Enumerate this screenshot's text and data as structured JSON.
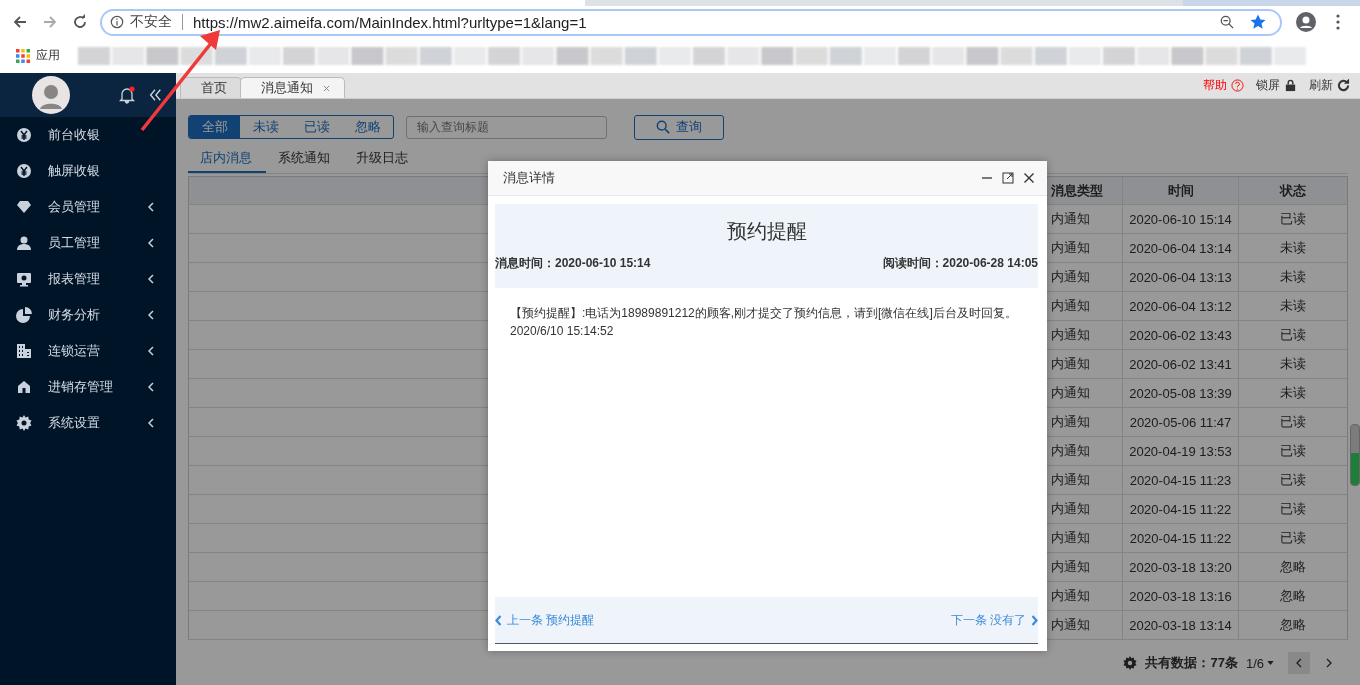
{
  "browser": {
    "security_label": "不安全",
    "url": "https://mw2.aimeifa.com/MainIndex.html?urltype=1&lang=1",
    "bookmarks_label": "应用"
  },
  "bell": {
    "has_unread": true
  },
  "sidebar": {
    "items": [
      {
        "label": "前台收银",
        "has_submenu": false
      },
      {
        "label": "触屏收银",
        "has_submenu": false
      },
      {
        "label": "会员管理",
        "has_submenu": true
      },
      {
        "label": "员工管理",
        "has_submenu": true
      },
      {
        "label": "报表管理",
        "has_submenu": true
      },
      {
        "label": "财务分析",
        "has_submenu": true
      },
      {
        "label": "连锁运营",
        "has_submenu": true
      },
      {
        "label": "进销存管理",
        "has_submenu": true
      },
      {
        "label": "系统设置",
        "has_submenu": true
      }
    ]
  },
  "tabs": [
    {
      "label": "首页",
      "selected": false,
      "closable": false
    },
    {
      "label": "消息通知",
      "selected": true,
      "closable": true
    }
  ],
  "toolbar": [
    {
      "label": "帮助",
      "color": "#ff0000"
    },
    {
      "label": "锁屏",
      "color": "#333333"
    },
    {
      "label": "刷新",
      "color": "#333333"
    }
  ],
  "filters": [
    {
      "label": "全部",
      "selected": true
    },
    {
      "label": "未读",
      "selected": false
    },
    {
      "label": "已读",
      "selected": false
    },
    {
      "label": "忽略",
      "selected": false
    }
  ],
  "search": {
    "placeholder": "输入查询标题"
  },
  "search_button": "查询",
  "subtabs": [
    {
      "label": "店内消息",
      "selected": true
    },
    {
      "label": "系统通知",
      "selected": false
    },
    {
      "label": "升级日志",
      "selected": false
    }
  ],
  "table": {
    "columns": [
      "消息类型",
      "时间",
      "状态"
    ],
    "rows": [
      {
        "type": "内通知",
        "time": "2020-06-10 15:14",
        "status": "已读"
      },
      {
        "type": "内通知",
        "time": "2020-06-04 13:14",
        "status": "未读"
      },
      {
        "type": "内通知",
        "time": "2020-06-04 13:13",
        "status": "未读"
      },
      {
        "type": "内通知",
        "time": "2020-06-04 13:12",
        "status": "未读"
      },
      {
        "type": "内通知",
        "time": "2020-06-02 13:43",
        "status": "已读"
      },
      {
        "type": "内通知",
        "time": "2020-06-02 13:41",
        "status": "未读"
      },
      {
        "type": "内通知",
        "time": "2020-05-08 13:39",
        "status": "未读"
      },
      {
        "type": "内通知",
        "time": "2020-05-06 11:47",
        "status": "已读"
      },
      {
        "type": "内通知",
        "time": "2020-04-19 13:53",
        "status": "已读"
      },
      {
        "type": "内通知",
        "time": "2020-04-15 11:23",
        "status": "已读"
      },
      {
        "type": "内通知",
        "time": "2020-04-15 11:22",
        "status": "已读"
      },
      {
        "type": "内通知",
        "time": "2020-04-15 11:22",
        "status": "已读"
      },
      {
        "type": "内通知",
        "time": "2020-03-18 13:20",
        "status": "忽略"
      },
      {
        "type": "内通知",
        "time": "2020-03-18 13:16",
        "status": "忽略"
      },
      {
        "type": "内通知",
        "time": "2020-03-18 13:14",
        "status": "忽略"
      }
    ]
  },
  "pagination": {
    "total": "共有数据：77条",
    "page": "1/6"
  },
  "modal": {
    "title": "消息详情",
    "heading": "预约提醒",
    "sent_time": "消息时间：2020-06-10 15:14",
    "read_time": "阅读时间：2020-06-28 14:05",
    "body": "【预约提醒】:电话为18989891212的顾客,刚才提交了预约信息，请到[微信在线]后台及时回复。",
    "body_date": "2020/6/10 15:14:52",
    "prev": {
      "label": "上一条",
      "title": "预约提醒"
    },
    "next": {
      "label": "下一条",
      "title": "没有了"
    }
  }
}
